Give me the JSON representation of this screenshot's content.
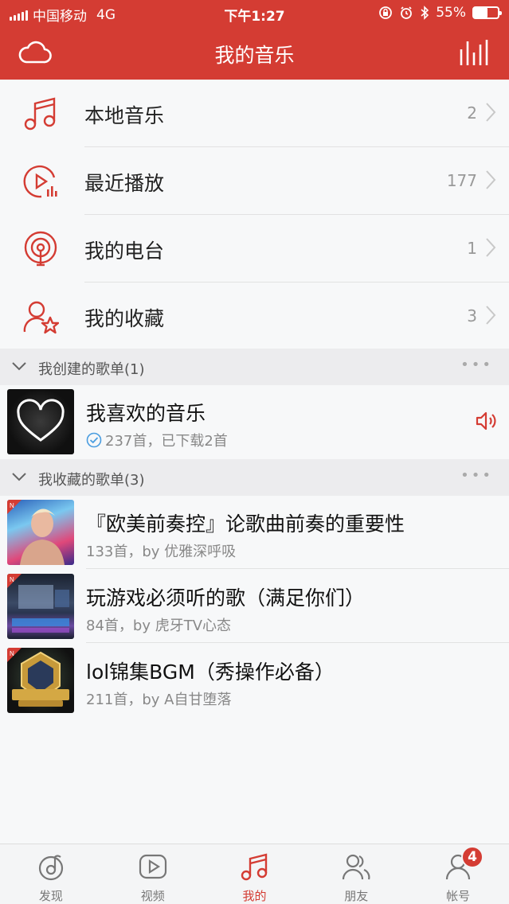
{
  "status_bar": {
    "carrier": "中国移动",
    "network": "4G",
    "time": "下午1:27",
    "battery_percent": "55%",
    "battery_level": 0.55
  },
  "nav": {
    "title": "我的音乐",
    "left_icon": "cloud-icon",
    "right_icon": "equalizer-icon"
  },
  "menu": [
    {
      "label": "本地音乐",
      "count": "2",
      "icon": "music-note-icon"
    },
    {
      "label": "最近播放",
      "count": "177",
      "icon": "recent-play-icon"
    },
    {
      "label": "我的电台",
      "count": "1",
      "icon": "radio-icon"
    },
    {
      "label": "我的收藏",
      "count": "3",
      "icon": "user-star-icon"
    }
  ],
  "created_section": {
    "title": "我创建的歌单(1)",
    "more": "•••"
  },
  "created_playlists": [
    {
      "title": "我喜欢的音乐",
      "subtitle": "237首，已下载2首"
    }
  ],
  "collected_section": {
    "title": "我收藏的歌单(3)",
    "more": "•••"
  },
  "collected_playlists": [
    {
      "title": "『欧美前奏控』论歌曲前奏的重要性",
      "subtitle": "133首，by 优雅深呼吸"
    },
    {
      "title": "玩游戏必须听的歌（满足你们）",
      "subtitle": "84首，by 虎牙TV心态"
    },
    {
      "title": "lol锦集BGM（秀操作必备）",
      "subtitle": "211首，by A自甘堕落"
    }
  ],
  "tabs": [
    {
      "label": "发现",
      "icon": "discover-icon"
    },
    {
      "label": "视频",
      "icon": "video-icon"
    },
    {
      "label": "我的",
      "icon": "music-icon",
      "active": true
    },
    {
      "label": "朋友",
      "icon": "friends-icon"
    },
    {
      "label": "帐号",
      "icon": "account-icon",
      "badge": "4"
    }
  ],
  "colors": {
    "brand_red": "#d43c33",
    "check_blue": "#4a9de0"
  }
}
